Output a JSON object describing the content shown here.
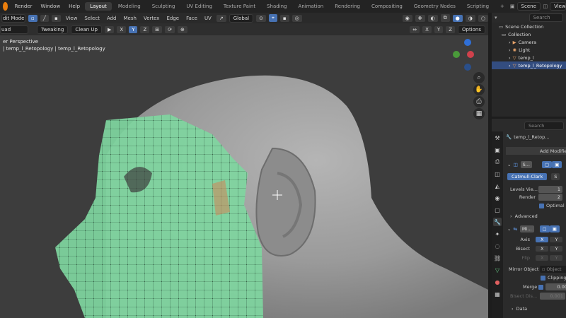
{
  "topbar": {
    "menus": [
      "Render",
      "Window",
      "Help"
    ],
    "workspaces": [
      "Layout",
      "Modeling",
      "Sculpting",
      "UV Editing",
      "Texture Paint",
      "Shading",
      "Animation",
      "Rendering",
      "Compositing",
      "Geometry Nodes",
      "Scripting"
    ],
    "active_workspace": "Layout",
    "add_tab": "+",
    "scene_label": "Scene",
    "viewlayer_label": "ViewLa"
  },
  "header2": {
    "mode": "dit Mode",
    "menus": [
      "View",
      "Select",
      "Add",
      "Mesh",
      "Vertex",
      "Edge",
      "Face",
      "UV"
    ],
    "transform": "Global",
    "search_placeholder": "Search"
  },
  "header3": {
    "brush": "uad",
    "tweak": "Tweaking",
    "cleanup": "Clean Up",
    "axes": [
      "X",
      "Y",
      "Z"
    ],
    "axes_right": [
      "X",
      "Y",
      "Z"
    ],
    "options": "Options"
  },
  "viewport": {
    "title": "er Perspective",
    "subtitle": "| temp_l_Retopology | temp_l_Retopology"
  },
  "outliner": {
    "root": "Scene Collection",
    "collection": "Collection",
    "items": [
      "Camera",
      "Light",
      "temp_l",
      "temp_l_Retopology"
    ],
    "selected": "temp_l_Retopology"
  },
  "properties": {
    "object_name": "temp_l_Retop...",
    "add_modifier": "Add Modifier",
    "subsurf_name": "S...",
    "subsurf_type": "Catmull-Clark",
    "subsurf_type_2": "S",
    "levels_label": "Levels Vie...",
    "levels_value": "1",
    "render_label": "Render",
    "render_value": "2",
    "optimal": "Optimal D",
    "advanced": "Advanced",
    "mirror_name": "Mi...",
    "axis_label": "Axis",
    "bisect_label": "Bisect",
    "flip_label": "Flip",
    "x": "X",
    "y": "Y",
    "mirror_object_label": "Mirror Object",
    "mirror_object_placeholder": "Object",
    "clipping": "Clipping",
    "merge_label": "Merge",
    "merge_value": "0.00",
    "bisect_dist_label": "Bisect Dis...",
    "bisect_dist_value": "0.001",
    "data": "Data",
    "search_placeholder": "Search"
  },
  "colors": {
    "accent": "#4772b3",
    "mesh_overlay": "#7fd6a0",
    "background": "#3d3d3d"
  }
}
